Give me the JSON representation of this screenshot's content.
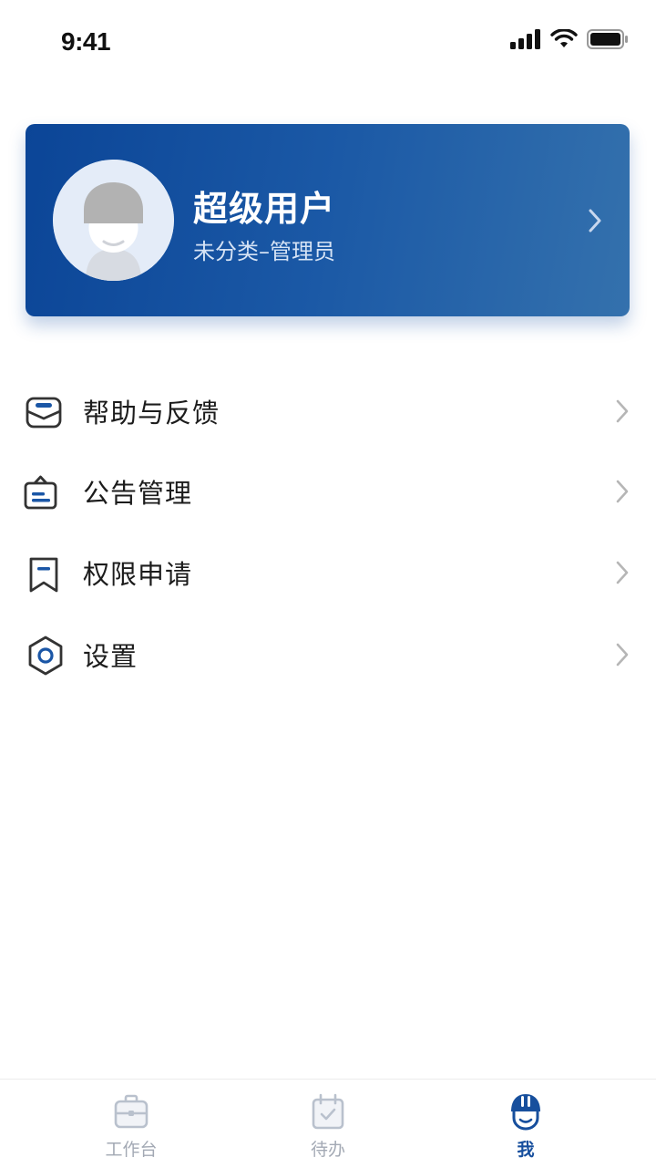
{
  "status_bar": {
    "time": "9:41"
  },
  "profile": {
    "name": "超级用户",
    "role": "未分类–管理员"
  },
  "menu": {
    "items": [
      {
        "label": "帮助与反馈",
        "icon": "feedback-inbox-icon"
      },
      {
        "label": "公告管理",
        "icon": "announcement-board-icon"
      },
      {
        "label": "权限申请",
        "icon": "bookmark-permission-icon"
      },
      {
        "label": "设置",
        "icon": "settings-hexagon-icon"
      }
    ]
  },
  "tab_bar": {
    "tabs": [
      {
        "label": "工作台",
        "icon": "briefcase-icon",
        "active": false
      },
      {
        "label": "待办",
        "icon": "calendar-check-icon",
        "active": false
      },
      {
        "label": "我",
        "icon": "helmet-user-icon",
        "active": true
      }
    ]
  },
  "colors": {
    "brand": "#174f9d",
    "card_gradient_start": "#0b4597",
    "card_gradient_end": "#3471ad",
    "inactive_tab": "#a3a9b4"
  }
}
